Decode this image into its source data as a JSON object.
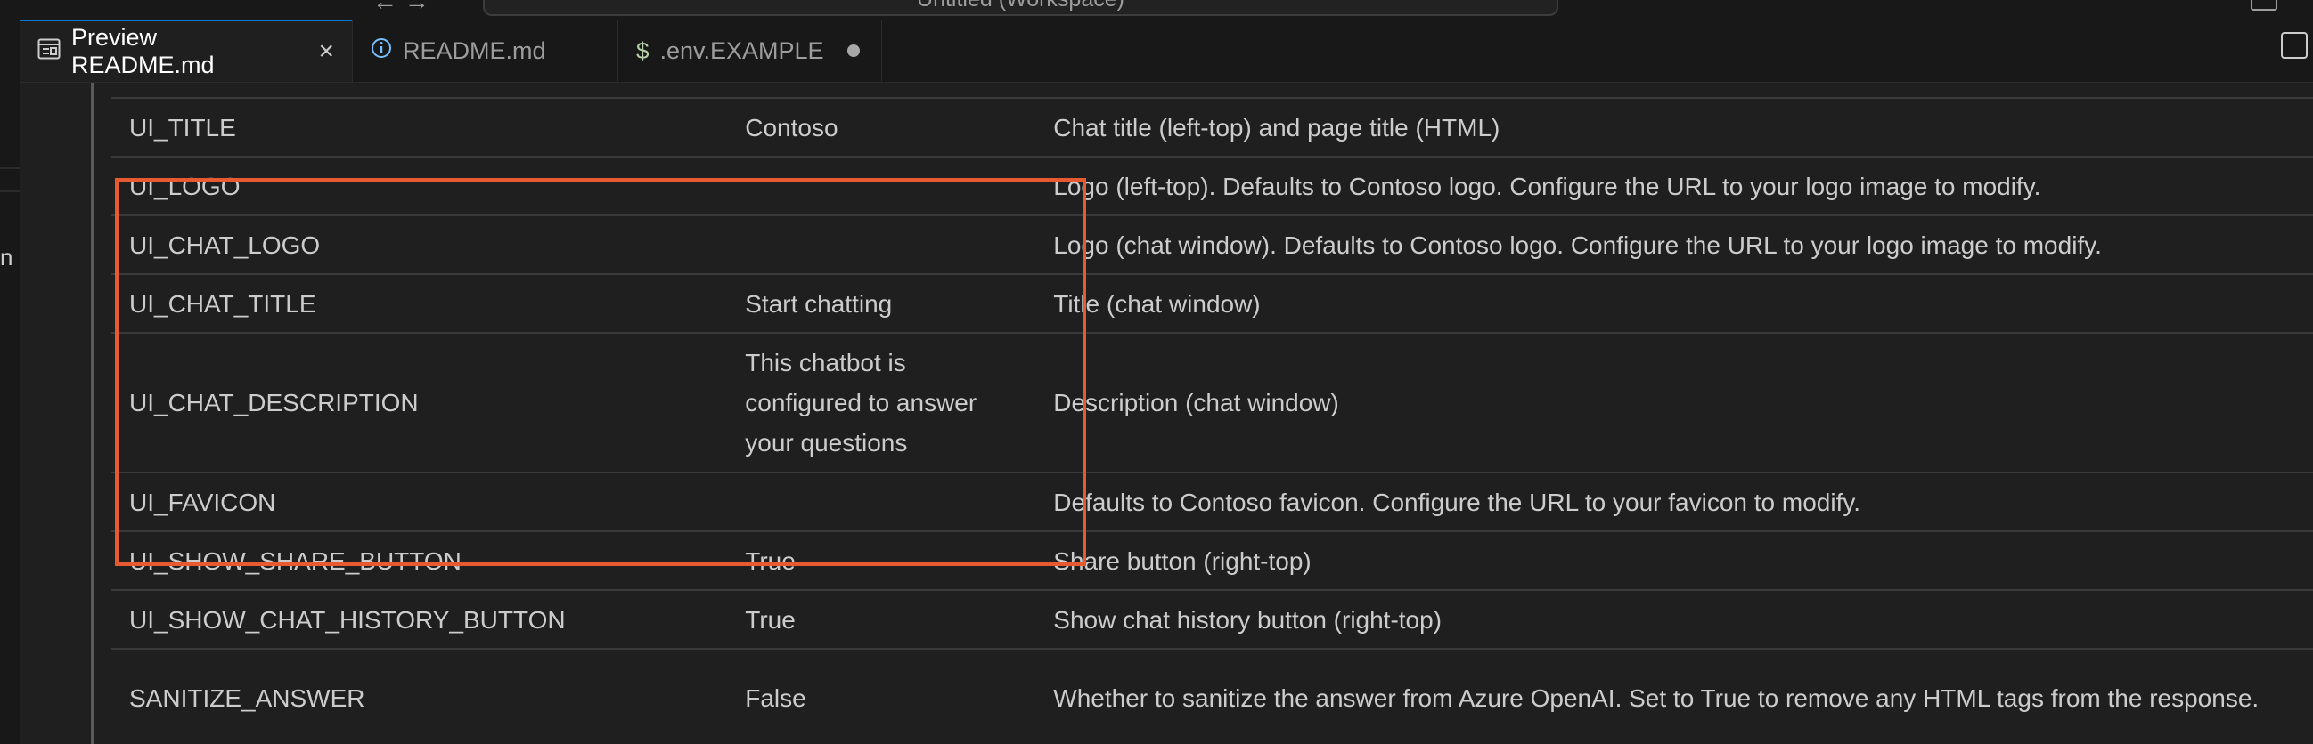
{
  "window": {
    "command_center_text": "Untitled (Workspace)",
    "nav_text": "← →"
  },
  "tabs": [
    {
      "label": "Preview README.md",
      "icon": "preview-icon",
      "active": true,
      "close": "×"
    },
    {
      "label": "README.md",
      "icon": "info-icon",
      "active": false
    },
    {
      "label": ".env.EXAMPLE",
      "icon": "dollar-icon",
      "icon_glyph": "$",
      "active": false,
      "dirty": true
    }
  ],
  "colors": {
    "highlight": "#e65a32",
    "accent": "#0078d4",
    "env_icon": "#b5cea8",
    "info_icon": "#75beff"
  },
  "table": {
    "rows": [
      {
        "setting": "UI_TITLE",
        "default": "Contoso",
        "description": "Chat title (left-top) and page title (HTML)"
      },
      {
        "setting": "UI_LOGO",
        "default": "",
        "description": "Logo (left-top). Defaults to Contoso logo. Configure the URL to your logo image to modify."
      },
      {
        "setting": "UI_CHAT_LOGO",
        "default": "",
        "description": "Logo (chat window). Defaults to Contoso logo. Configure the URL to your logo image to modify."
      },
      {
        "setting": "UI_CHAT_TITLE",
        "default": "Start chatting",
        "description": "Title (chat window)"
      },
      {
        "setting": "UI_CHAT_DESCRIPTION",
        "default": "This chatbot is configured to answer your questions",
        "description": "Description (chat window)"
      },
      {
        "setting": "UI_FAVICON",
        "default": "",
        "description": "Defaults to Contoso favicon. Configure the URL to your favicon to modify."
      },
      {
        "setting": "UI_SHOW_SHARE_BUTTON",
        "default": "True",
        "description": "Share button (right-top)"
      },
      {
        "setting": "UI_SHOW_CHAT_HISTORY_BUTTON",
        "default": "True",
        "description": "Show chat history button (right-top)"
      },
      {
        "setting": "SANITIZE_ANSWER",
        "default": "False",
        "description": "Whether to sanitize the answer from Azure OpenAI. Set to True to remove any HTML tags from the response."
      }
    ]
  }
}
